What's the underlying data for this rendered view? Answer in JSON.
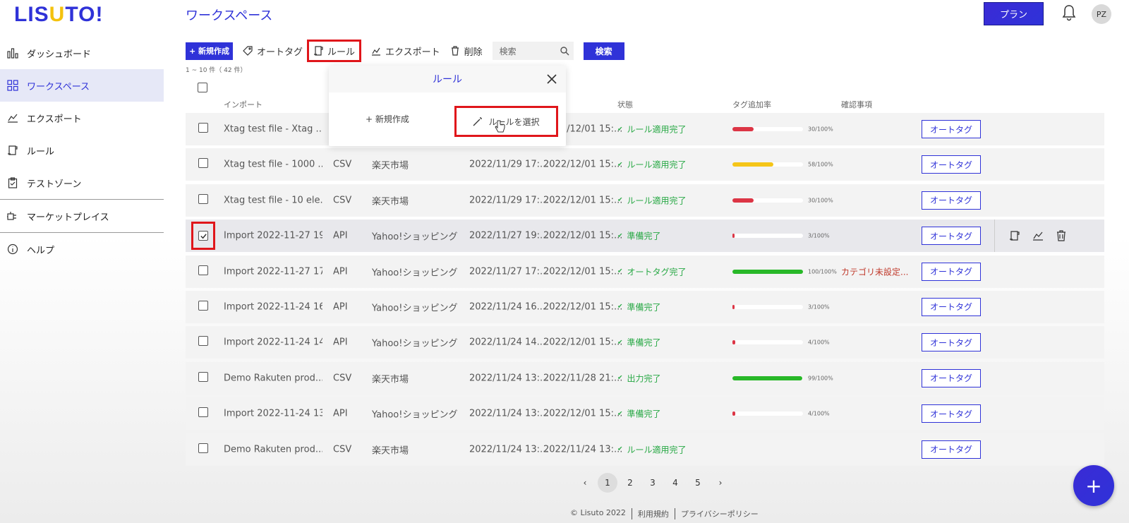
{
  "logo": {
    "text_a": "LIS",
    "text_u": "U",
    "text_b": "TO!"
  },
  "page_title": "ワークスペース",
  "header": {
    "plan_label": "プラン",
    "avatar_initials": "PZ"
  },
  "sidebar": {
    "items": [
      {
        "label": "ダッシュボード",
        "icon": "chart-icon"
      },
      {
        "label": "ワークスペース",
        "icon": "grid-icon",
        "active": true
      },
      {
        "label": "エクスポート",
        "icon": "export-icon"
      },
      {
        "label": "ルール",
        "icon": "rule-icon"
      },
      {
        "label": "テストゾーン",
        "icon": "clipboard-icon"
      },
      {
        "label": "マーケットプレイス",
        "icon": "plug-icon"
      },
      {
        "label": "ヘルプ",
        "icon": "info-icon"
      }
    ]
  },
  "toolbar": {
    "new_label": "+ 新規作成",
    "autotag_label": "オートタグ",
    "rule_label": "ルール",
    "export_label": "エクスポート",
    "delete_label": "削除",
    "search_placeholder": "検索",
    "search_button": "検索"
  },
  "count_text": "1 ~ 10 件（ 42 件）",
  "columns": {
    "import": "インポート",
    "status": "状態",
    "tag_rate": "タグ追加率",
    "notes": "確認事項"
  },
  "popup": {
    "title": "ルール",
    "new_label": "+ 新規作成",
    "select_label": "ルールを選択"
  },
  "colors": {
    "accent": "#2f32d8",
    "red_bar": "#dc3545",
    "yellow_bar": "#f5c518",
    "green_bar": "#28b828",
    "highlight": "#e0161b"
  },
  "rows": [
    {
      "name": "Xtag test file - Xtag ...",
      "type": "",
      "store": "",
      "date1": "",
      "date2": "2022/12/01 15:...",
      "status": "ルール適用完了",
      "progress": 30,
      "pct": "30/100%",
      "note": "",
      "btn": "オートタグ"
    },
    {
      "name": "Xtag test file - 1000 ...",
      "type": "CSV",
      "store": "楽天市場",
      "date1": "2022/11/29 17:...",
      "date2": "2022/12/01 15:...",
      "status": "ルール適用完了",
      "progress": 58,
      "pct": "58/100%",
      "note": "",
      "btn": "オートタグ"
    },
    {
      "name": "Xtag test file - 10 ele...",
      "type": "CSV",
      "store": "楽天市場",
      "date1": "2022/11/29 17:...",
      "date2": "2022/12/01 15:...",
      "status": "ルール適用完了",
      "progress": 30,
      "pct": "30/100%",
      "note": "",
      "btn": "オートタグ"
    },
    {
      "name": "Import 2022-11-27 19:...",
      "type": "API",
      "store": "Yahoo!ショッピング",
      "date1": "2022/11/27 19:...",
      "date2": "2022/12/01 15:...",
      "status": "準備完了",
      "progress": 3,
      "pct": "3/100%",
      "note": "",
      "btn": "オートタグ",
      "checked": true
    },
    {
      "name": "Import 2022-11-27 17:...",
      "type": "API",
      "store": "Yahoo!ショッピング",
      "date1": "2022/11/27 17:...",
      "date2": "2022/12/01 15:...",
      "status": "オートタグ完了",
      "progress": 100,
      "pct": "100/100%",
      "note": "カテゴリ未設定...",
      "btn": "オートタグ"
    },
    {
      "name": "Import 2022-11-24 16:...",
      "type": "API",
      "store": "Yahoo!ショッピング",
      "date1": "2022/11/24 16...",
      "date2": "2022/12/01 15:...",
      "status": "準備完了",
      "progress": 3,
      "pct": "3/100%",
      "note": "",
      "btn": "オートタグ"
    },
    {
      "name": "Import 2022-11-24 14:...",
      "type": "API",
      "store": "Yahoo!ショッピング",
      "date1": "2022/11/24 14...",
      "date2": "2022/12/01 15:...",
      "status": "準備完了",
      "progress": 4,
      "pct": "4/100%",
      "note": "",
      "btn": "オートタグ"
    },
    {
      "name": "Demo Rakuten prod...",
      "type": "CSV",
      "store": "楽天市場",
      "date1": "2022/11/24 13:...",
      "date2": "2022/11/28 21:...",
      "status": "出力完了",
      "progress": 99,
      "pct": "99/100%",
      "note": "",
      "btn": "オートタグ"
    },
    {
      "name": "Import 2022-11-24 13:...",
      "type": "API",
      "store": "Yahoo!ショッピング",
      "date1": "2022/11/24 13:...",
      "date2": "2022/12/01 15:...",
      "status": "準備完了",
      "progress": 4,
      "pct": "4/100%",
      "note": "",
      "btn": "オートタグ"
    },
    {
      "name": "Demo Rakuten prod...",
      "type": "CSV",
      "store": "楽天市場",
      "date1": "2022/11/24 13:...",
      "date2": "2022/11/24 13:...",
      "status": "ルール適用完了",
      "progress": null,
      "pct": "",
      "note": "",
      "btn": "オートタグ"
    }
  ],
  "pager": {
    "prev": "‹",
    "pages": [
      "1",
      "2",
      "3",
      "4",
      "5"
    ],
    "current": "1",
    "next": "›"
  },
  "footer": {
    "copyright": "© Lisuto 2022",
    "terms": "利用規約",
    "privacy": "プライバシーポリシー"
  },
  "fab_label": "+"
}
